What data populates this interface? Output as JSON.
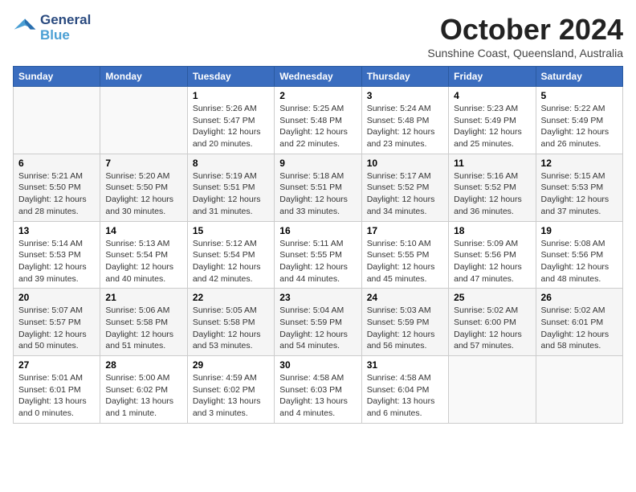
{
  "header": {
    "logo_line1": "General",
    "logo_line2": "Blue",
    "month_title": "October 2024",
    "location": "Sunshine Coast, Queensland, Australia"
  },
  "weekdays": [
    "Sunday",
    "Monday",
    "Tuesday",
    "Wednesday",
    "Thursday",
    "Friday",
    "Saturday"
  ],
  "weeks": [
    [
      {
        "day": "",
        "info": ""
      },
      {
        "day": "",
        "info": ""
      },
      {
        "day": "1",
        "info": "Sunrise: 5:26 AM\nSunset: 5:47 PM\nDaylight: 12 hours\nand 20 minutes."
      },
      {
        "day": "2",
        "info": "Sunrise: 5:25 AM\nSunset: 5:48 PM\nDaylight: 12 hours\nand 22 minutes."
      },
      {
        "day": "3",
        "info": "Sunrise: 5:24 AM\nSunset: 5:48 PM\nDaylight: 12 hours\nand 23 minutes."
      },
      {
        "day": "4",
        "info": "Sunrise: 5:23 AM\nSunset: 5:49 PM\nDaylight: 12 hours\nand 25 minutes."
      },
      {
        "day": "5",
        "info": "Sunrise: 5:22 AM\nSunset: 5:49 PM\nDaylight: 12 hours\nand 26 minutes."
      }
    ],
    [
      {
        "day": "6",
        "info": "Sunrise: 5:21 AM\nSunset: 5:50 PM\nDaylight: 12 hours\nand 28 minutes."
      },
      {
        "day": "7",
        "info": "Sunrise: 5:20 AM\nSunset: 5:50 PM\nDaylight: 12 hours\nand 30 minutes."
      },
      {
        "day": "8",
        "info": "Sunrise: 5:19 AM\nSunset: 5:51 PM\nDaylight: 12 hours\nand 31 minutes."
      },
      {
        "day": "9",
        "info": "Sunrise: 5:18 AM\nSunset: 5:51 PM\nDaylight: 12 hours\nand 33 minutes."
      },
      {
        "day": "10",
        "info": "Sunrise: 5:17 AM\nSunset: 5:52 PM\nDaylight: 12 hours\nand 34 minutes."
      },
      {
        "day": "11",
        "info": "Sunrise: 5:16 AM\nSunset: 5:52 PM\nDaylight: 12 hours\nand 36 minutes."
      },
      {
        "day": "12",
        "info": "Sunrise: 5:15 AM\nSunset: 5:53 PM\nDaylight: 12 hours\nand 37 minutes."
      }
    ],
    [
      {
        "day": "13",
        "info": "Sunrise: 5:14 AM\nSunset: 5:53 PM\nDaylight: 12 hours\nand 39 minutes."
      },
      {
        "day": "14",
        "info": "Sunrise: 5:13 AM\nSunset: 5:54 PM\nDaylight: 12 hours\nand 40 minutes."
      },
      {
        "day": "15",
        "info": "Sunrise: 5:12 AM\nSunset: 5:54 PM\nDaylight: 12 hours\nand 42 minutes."
      },
      {
        "day": "16",
        "info": "Sunrise: 5:11 AM\nSunset: 5:55 PM\nDaylight: 12 hours\nand 44 minutes."
      },
      {
        "day": "17",
        "info": "Sunrise: 5:10 AM\nSunset: 5:55 PM\nDaylight: 12 hours\nand 45 minutes."
      },
      {
        "day": "18",
        "info": "Sunrise: 5:09 AM\nSunset: 5:56 PM\nDaylight: 12 hours\nand 47 minutes."
      },
      {
        "day": "19",
        "info": "Sunrise: 5:08 AM\nSunset: 5:56 PM\nDaylight: 12 hours\nand 48 minutes."
      }
    ],
    [
      {
        "day": "20",
        "info": "Sunrise: 5:07 AM\nSunset: 5:57 PM\nDaylight: 12 hours\nand 50 minutes."
      },
      {
        "day": "21",
        "info": "Sunrise: 5:06 AM\nSunset: 5:58 PM\nDaylight: 12 hours\nand 51 minutes."
      },
      {
        "day": "22",
        "info": "Sunrise: 5:05 AM\nSunset: 5:58 PM\nDaylight: 12 hours\nand 53 minutes."
      },
      {
        "day": "23",
        "info": "Sunrise: 5:04 AM\nSunset: 5:59 PM\nDaylight: 12 hours\nand 54 minutes."
      },
      {
        "day": "24",
        "info": "Sunrise: 5:03 AM\nSunset: 5:59 PM\nDaylight: 12 hours\nand 56 minutes."
      },
      {
        "day": "25",
        "info": "Sunrise: 5:02 AM\nSunset: 6:00 PM\nDaylight: 12 hours\nand 57 minutes."
      },
      {
        "day": "26",
        "info": "Sunrise: 5:02 AM\nSunset: 6:01 PM\nDaylight: 12 hours\nand 58 minutes."
      }
    ],
    [
      {
        "day": "27",
        "info": "Sunrise: 5:01 AM\nSunset: 6:01 PM\nDaylight: 13 hours\nand 0 minutes."
      },
      {
        "day": "28",
        "info": "Sunrise: 5:00 AM\nSunset: 6:02 PM\nDaylight: 13 hours\nand 1 minute."
      },
      {
        "day": "29",
        "info": "Sunrise: 4:59 AM\nSunset: 6:02 PM\nDaylight: 13 hours\nand 3 minutes."
      },
      {
        "day": "30",
        "info": "Sunrise: 4:58 AM\nSunset: 6:03 PM\nDaylight: 13 hours\nand 4 minutes."
      },
      {
        "day": "31",
        "info": "Sunrise: 4:58 AM\nSunset: 6:04 PM\nDaylight: 13 hours\nand 6 minutes."
      },
      {
        "day": "",
        "info": ""
      },
      {
        "day": "",
        "info": ""
      }
    ]
  ]
}
